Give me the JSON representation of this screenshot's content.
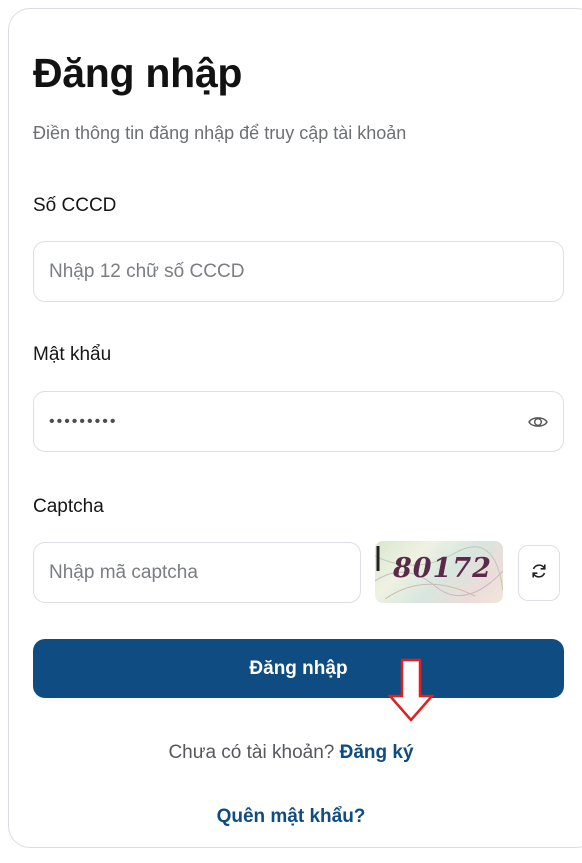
{
  "login": {
    "title": "Đăng nhập",
    "subtitle": "Điền thông tin đăng nhập để truy cập tài khoản"
  },
  "cccd": {
    "label": "Số CCCD",
    "placeholder": "Nhập 12 chữ số CCCD"
  },
  "password": {
    "label": "Mật khẩu",
    "masked_value": "•••••••••",
    "toggle_icon": "eye-icon"
  },
  "captcha": {
    "label": "Captcha",
    "placeholder": "Nhập mã captcha",
    "image_text": "80172",
    "refresh_icon": "refresh-icon"
  },
  "submit": {
    "label": "Đăng nhập"
  },
  "signup": {
    "prompt": "Chưa có tài khoản?",
    "link": "Đăng ký"
  },
  "forgot": {
    "link": "Quên mật khẩu?"
  },
  "colors": {
    "primary": "#0f4c81",
    "annotation_arrow": "#e02020",
    "border": "#dcdfe3"
  }
}
